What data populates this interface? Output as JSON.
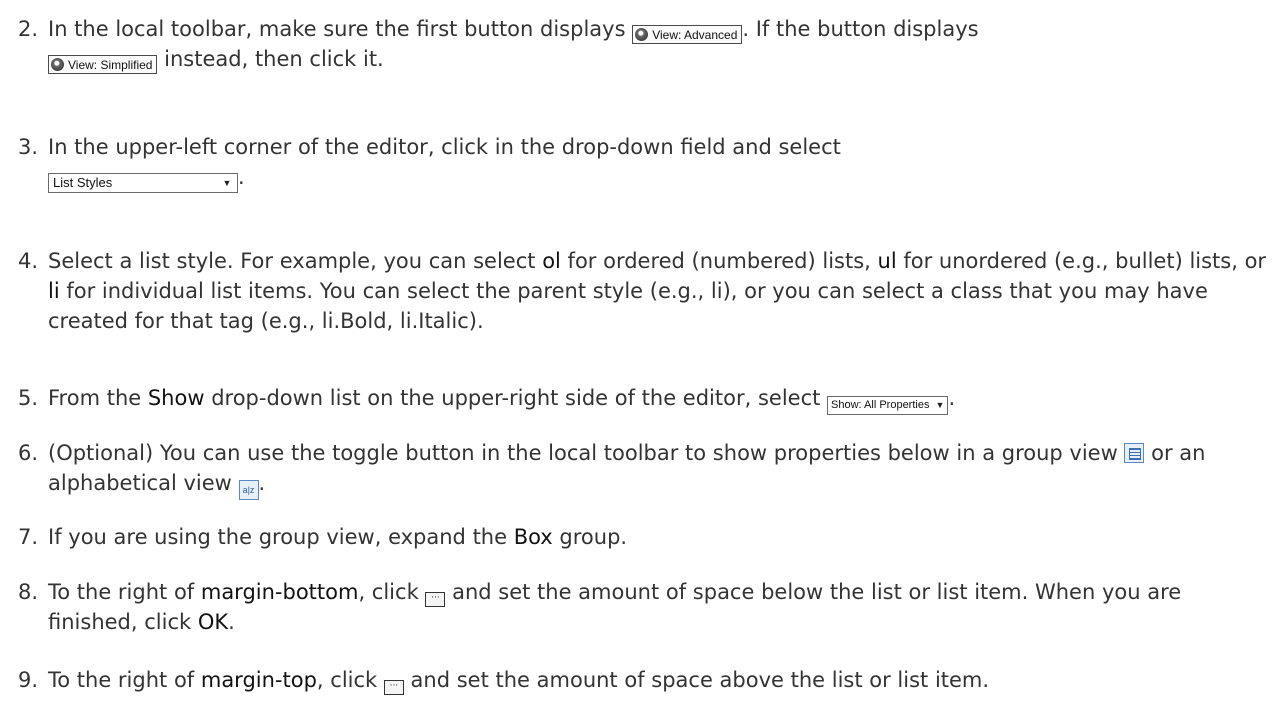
{
  "steps": [
    {
      "num": "2.",
      "a": "In the local toolbar, make sure the first button displays ",
      "btn1": "View: Advanced",
      "b": ". If the button displays",
      "btn2": "View: Simplified",
      "c": " instead, then click it."
    },
    {
      "num": "3.",
      "a": "In the upper-left corner of the editor, click in the drop-down field and select",
      "select": "List Styles",
      "b": "."
    },
    {
      "num": "4.",
      "a": "Select a list style. For example, you can select ",
      "kw1": "ol",
      "b": " for ordered (numbered) lists, ",
      "kw2": "ul",
      "c": " for unordered (e.g., bullet) lists, or ",
      "kw3": "li",
      "d": " for individual list items. You can select the parent style (e.g., li), or you can select a class that you may have created for that tag (e.g., li.Bold, li.Italic)."
    },
    {
      "num": "5.",
      "a": "From the ",
      "kw": "Show",
      "b": " drop-down list on the upper-right side of the editor, select ",
      "select": "Show: All Properties",
      "c": "."
    },
    {
      "num": "6.",
      "a": "(Optional) You can use the toggle button in the local toolbar to show properties below in a group view ",
      "b": " or an alphabetical view ",
      "alpha_icon_text": "a|z",
      "c": "."
    },
    {
      "num": "7.",
      "a": "If you are using the group view, expand the ",
      "kw": "Box",
      "b": " group."
    },
    {
      "num": "8.",
      "a": "To the right of ",
      "kw": "margin-bottom",
      "b": ", click ",
      "c": " and set the amount of space below the list or list item. When you are finished, click ",
      "kw2": "OK",
      "d": "."
    },
    {
      "num": "9.",
      "a": "To the right of ",
      "kw": "margin-top",
      "b": ", click ",
      "c": " and set the amount of space above the list or list item."
    }
  ],
  "icons": {
    "ellipsis_glyph": "···",
    "caret_glyph": "▼"
  }
}
